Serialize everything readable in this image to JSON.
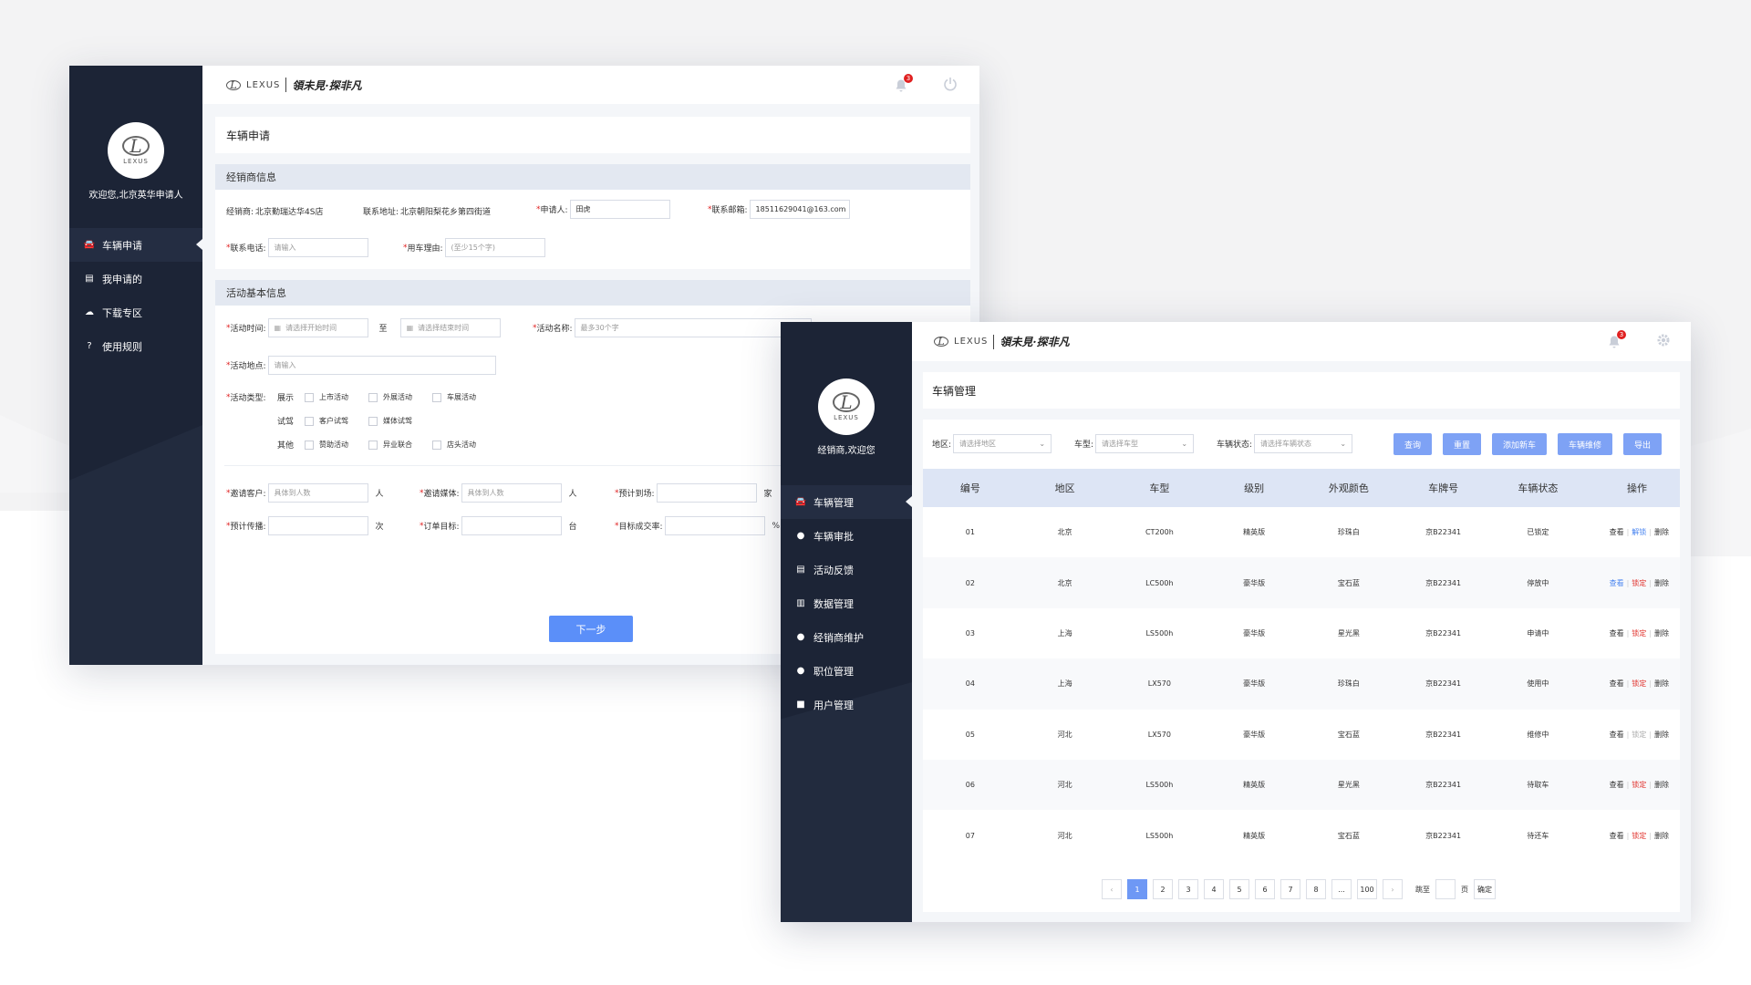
{
  "colors": {
    "sidebar": "#1c2436",
    "primary": "#5b8ff9",
    "header_row": "#dde5f5",
    "status_red": "#e0302a",
    "status_green": "#33b24a",
    "status_blue": "#4a85f0"
  },
  "brand": {
    "logo_text": "LEXUS",
    "slogan": "領未見·探非凡"
  },
  "win1": {
    "welcome": "欢迎您,北京英华申请人",
    "nav": [
      {
        "label": "车辆申请",
        "icon": "car-icon",
        "active": true
      },
      {
        "label": "我申请的",
        "icon": "clipboard-icon",
        "active": false
      },
      {
        "label": "下载专区",
        "icon": "cloud-download-icon",
        "active": false
      },
      {
        "label": "使用规则",
        "icon": "help-icon",
        "active": false
      }
    ],
    "notification_count": "3",
    "page_title": "车辆申请",
    "dealer_section": {
      "title": "经销商信息",
      "dealer_label": "经销商:",
      "dealer_value": "北京勤瑞达华4S店",
      "address_label": "联系地址:",
      "address_value": "北京朝阳梨花乡第四街道",
      "applicant_label": "申请人:",
      "applicant_value": "田虎",
      "email_label": "联系邮箱:",
      "email_value": "18511629041@163.com",
      "phone_label": "联系电话:",
      "phone_placeholder": "请输入",
      "reason_label": "用车理由:",
      "reason_placeholder": "(至少15个字)"
    },
    "activity_section": {
      "title": "活动基本信息",
      "time_label": "活动时间:",
      "start_placeholder": "请选择开始时间",
      "to": "至",
      "end_placeholder": "请选择结束时间",
      "name_label": "活动名称:",
      "name_placeholder": "最多30个字",
      "place_label": "活动地点:",
      "place_placeholder": "请输入",
      "type_label": "活动类型:",
      "type_rows": [
        {
          "group": "展示",
          "options": [
            "上市活动",
            "外展活动",
            "车展活动"
          ]
        },
        {
          "group": "试驾",
          "options": [
            "客户试驾",
            "媒体试驾"
          ]
        },
        {
          "group": "其他",
          "options": [
            "赞助活动",
            "异业联合",
            "店头活动"
          ]
        }
      ],
      "invite_customers_label": "邀请客户:",
      "invite_customers_placeholder": "具体到人数",
      "unit_person": "人",
      "invite_media_label": "邀请媒体:",
      "invite_media_placeholder": "具体到人数",
      "expected_arrival_label": "预计到场:",
      "unit_home": "家",
      "expected_spread_label": "预计传播:",
      "unit_times": "次",
      "order_target_label": "订单目标:",
      "unit_car": "台",
      "conversion_label": "目标成交率:",
      "unit_percent": "%"
    },
    "next_button": "下一步"
  },
  "win2": {
    "welcome": "经销商,欢迎您",
    "nav": [
      {
        "label": "车辆管理",
        "icon": "car-icon",
        "active": true
      },
      {
        "label": "车辆审批",
        "icon": "user-icon",
        "active": false
      },
      {
        "label": "活动反馈",
        "icon": "document-icon",
        "active": false
      },
      {
        "label": "数据管理",
        "icon": "bar-chart-icon",
        "active": false
      },
      {
        "label": "经销商维护",
        "icon": "user-edit-icon",
        "active": false
      },
      {
        "label": "职位管理",
        "icon": "user-settings-icon",
        "active": false
      },
      {
        "label": "用户管理",
        "icon": "briefcase-icon",
        "active": false
      }
    ],
    "notification_count": "3",
    "page_title": "车辆管理",
    "filters": {
      "region_label": "地区:",
      "region_placeholder": "请选择地区",
      "model_label": "车型:",
      "model_placeholder": "请选择车型",
      "status_label": "车辆状态:",
      "status_placeholder": "请选择车辆状态"
    },
    "buttons": {
      "query": "查询",
      "reset": "重置",
      "add": "添加新车",
      "repair": "车辆维修",
      "export": "导出"
    },
    "table": {
      "headers": [
        "编号",
        "地区",
        "车型",
        "级别",
        "外观颜色",
        "车牌号",
        "车辆状态",
        "操作"
      ],
      "rows": [
        {
          "id": "01",
          "region": "北京",
          "model": "CT200h",
          "level": "精英版",
          "color": "珍珠白",
          "plate": "京B22341",
          "status": "已锁定",
          "status_color": "red",
          "ops": [
            {
              "t": "查看",
              "c": ""
            },
            {
              "t": "解锁",
              "c": "blue"
            },
            {
              "t": "删除",
              "c": ""
            }
          ]
        },
        {
          "id": "02",
          "region": "北京",
          "model": "LC500h",
          "level": "豪华版",
          "color": "宝石蓝",
          "plate": "京B22341",
          "status": "停放中",
          "status_color": "green",
          "ops": [
            {
              "t": "查看",
              "c": "blue"
            },
            {
              "t": "锁定",
              "c": "red"
            },
            {
              "t": "删除",
              "c": ""
            }
          ]
        },
        {
          "id": "03",
          "region": "上海",
          "model": "LS500h",
          "level": "豪华版",
          "color": "星光黑",
          "plate": "京B22341",
          "status": "申请中",
          "status_color": "blue",
          "ops": [
            {
              "t": "查看",
              "c": ""
            },
            {
              "t": "锁定",
              "c": "red"
            },
            {
              "t": "删除",
              "c": ""
            }
          ]
        },
        {
          "id": "04",
          "region": "上海",
          "model": "LX570",
          "level": "豪华版",
          "color": "珍珠白",
          "plate": "京B22341",
          "status": "使用中",
          "status_color": "red",
          "ops": [
            {
              "t": "查看",
              "c": ""
            },
            {
              "t": "锁定",
              "c": "red"
            },
            {
              "t": "删除",
              "c": ""
            }
          ]
        },
        {
          "id": "05",
          "region": "河北",
          "model": "LX570",
          "level": "豪华版",
          "color": "宝石蓝",
          "plate": "京B22341",
          "status": "维修中",
          "status_color": "red",
          "ops": [
            {
              "t": "查看",
              "c": ""
            },
            {
              "t": "锁定",
              "c": "gray"
            },
            {
              "t": "删除",
              "c": ""
            }
          ]
        },
        {
          "id": "06",
          "region": "河北",
          "model": "LS500h",
          "level": "精英版",
          "color": "星光黑",
          "plate": "京B22341",
          "status": "待取车",
          "status_color": "blue",
          "ops": [
            {
              "t": "查看",
              "c": ""
            },
            {
              "t": "锁定",
              "c": "red"
            },
            {
              "t": "删除",
              "c": ""
            }
          ]
        },
        {
          "id": "07",
          "region": "河北",
          "model": "LS500h",
          "level": "精英版",
          "color": "宝石蓝",
          "plate": "京B22341",
          "status": "待还车",
          "status_color": "red",
          "ops": [
            {
              "t": "查看",
              "c": ""
            },
            {
              "t": "锁定",
              "c": "red"
            },
            {
              "t": "删除",
              "c": ""
            }
          ]
        }
      ]
    },
    "pagination": {
      "prev": "‹",
      "pages": [
        "1",
        "2",
        "3",
        "4",
        "5",
        "6",
        "7",
        "8",
        "...",
        "100"
      ],
      "current": "1",
      "next": "›",
      "goto_label": "跳至",
      "page_unit": "页",
      "confirm": "确定"
    }
  }
}
